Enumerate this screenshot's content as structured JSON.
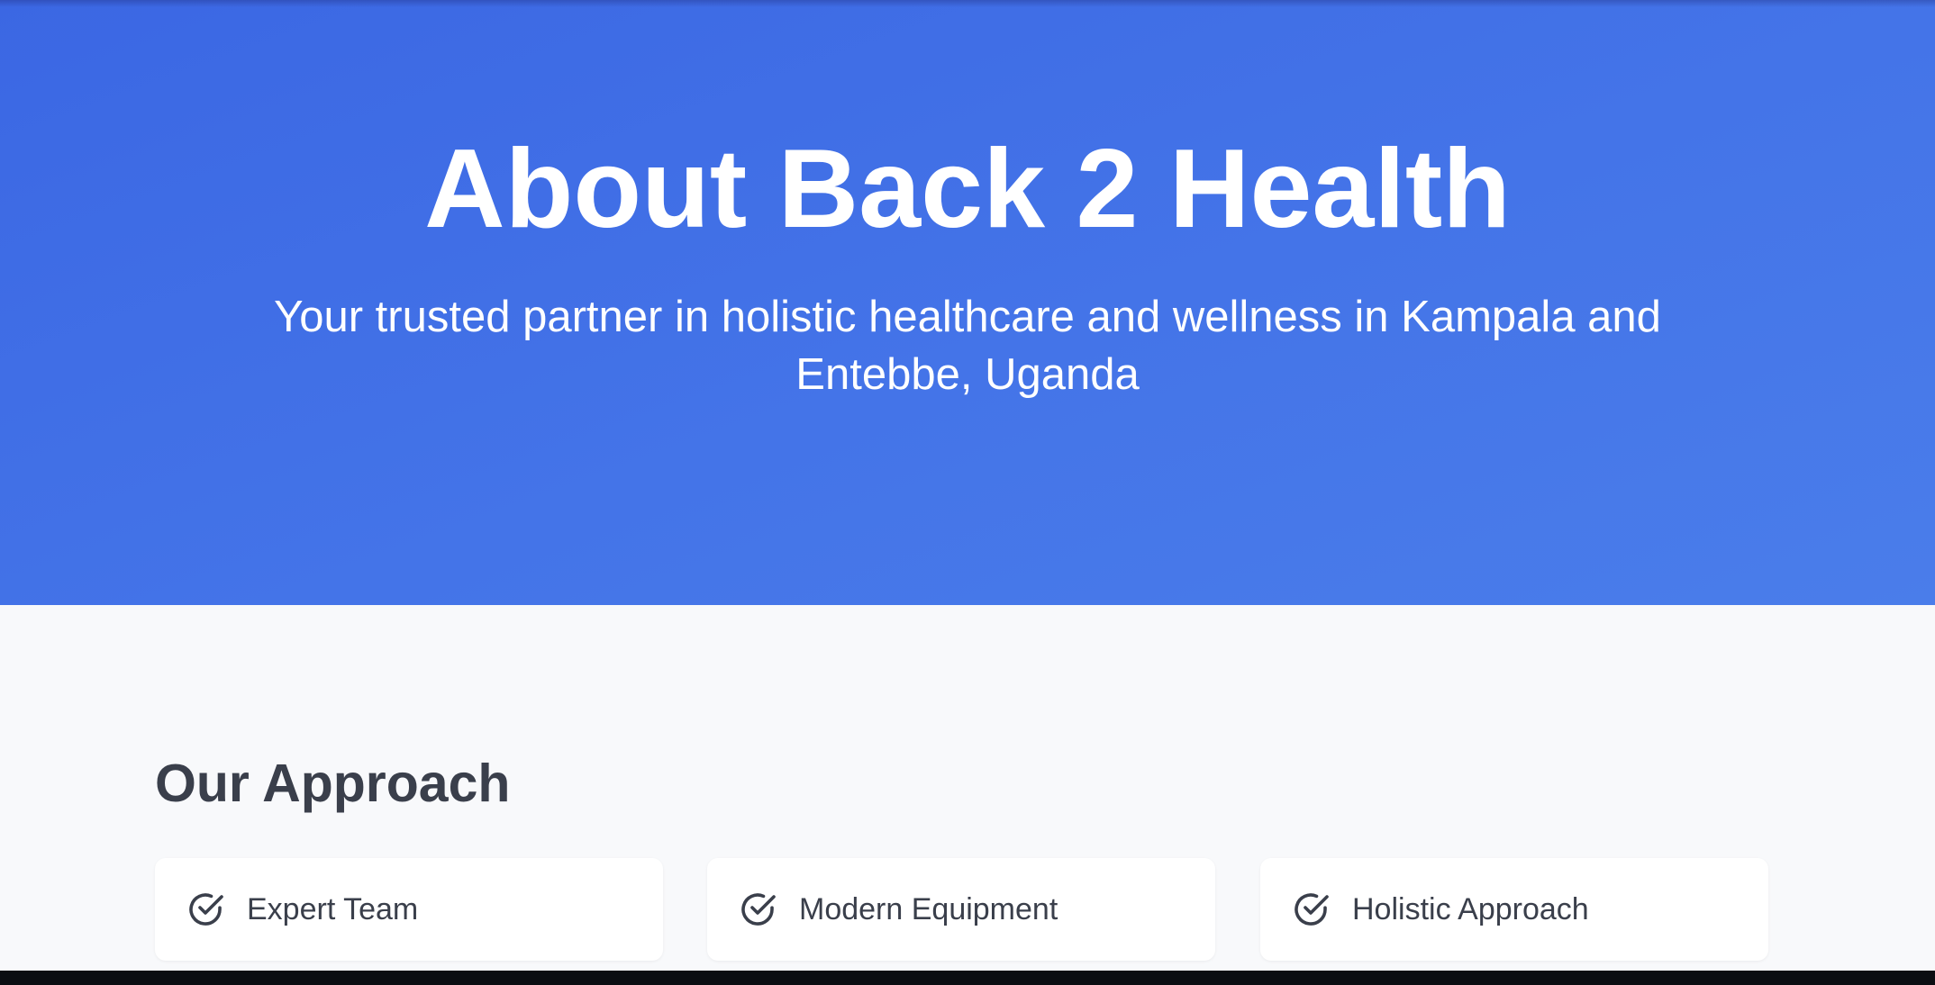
{
  "hero": {
    "title": "About Back 2 Health",
    "subtitle": "Your trusted partner in holistic healthcare and wellness in Kampala and Entebbe, Uganda",
    "gradient_colors": [
      "#3b67e3",
      "#4a7dea"
    ]
  },
  "approach": {
    "title": "Our Approach",
    "items": [
      {
        "label": "Expert Team",
        "icon": "check-circle-icon"
      },
      {
        "label": "Modern Equipment",
        "icon": "check-circle-icon"
      },
      {
        "label": "Holistic Approach",
        "icon": "check-circle-icon"
      }
    ]
  },
  "colors": {
    "background": "#f8f9fb",
    "text_dark": "#3a3f4b",
    "card": "#ffffff"
  }
}
